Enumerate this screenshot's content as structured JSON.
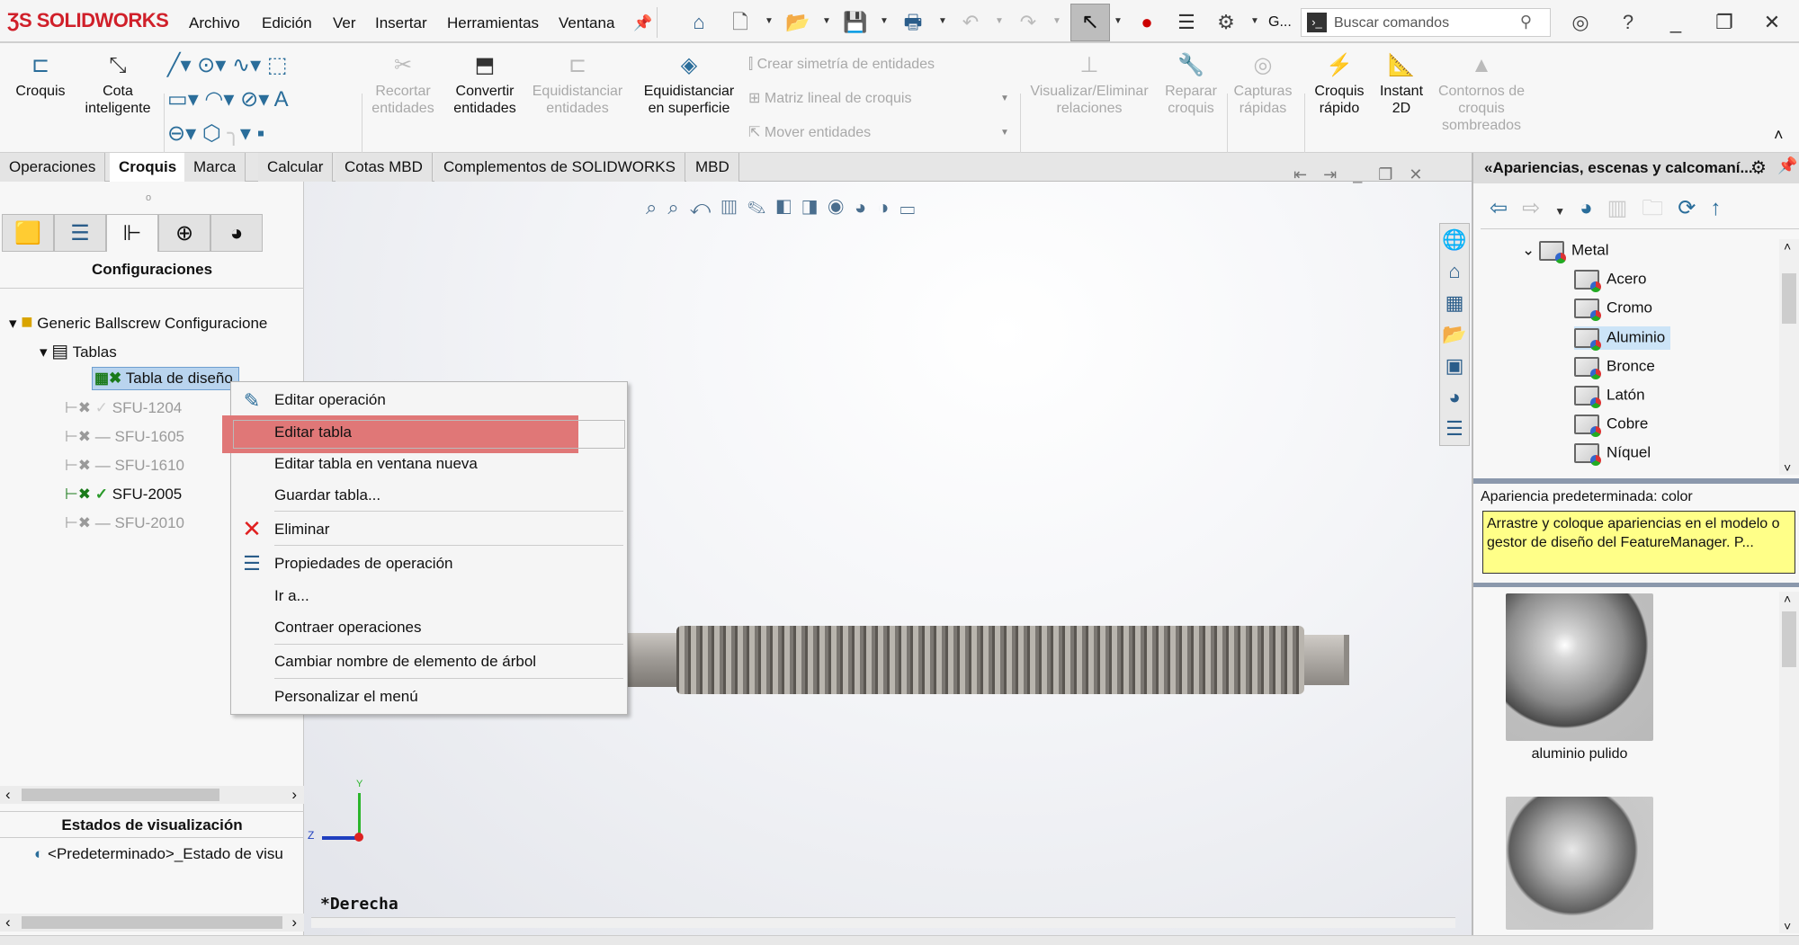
{
  "app": {
    "brand": "SOLIDWORKS"
  },
  "menu": [
    "Archivo",
    "Edición",
    "Ver",
    "Insertar",
    "Herramientas",
    "Ventana"
  ],
  "toolbar": {
    "overflow_label": "G...",
    "search_placeholder": "Buscar comandos"
  },
  "ribbon": {
    "croquis": "Croquis",
    "cota": "Cota inteligente",
    "recortar": "Recortar entidades",
    "convertir": "Convertir entidades",
    "equid": "Equidistanciar entidades",
    "equid_sup": "Equidistanciar en superficie",
    "simetria": "Crear simetría de entidades",
    "matriz": "Matriz lineal de croquis",
    "mover": "Mover entidades",
    "visualizar": "Visualizar/Eliminar relaciones",
    "reparar": "Reparar croquis",
    "capturas": "Capturas rápidas",
    "croquis_rapido": "Croquis rápido",
    "instant2d": "Instant 2D",
    "contornos": "Contornos de croquis sombreados"
  },
  "tabs": [
    {
      "label": "Operaciones"
    },
    {
      "label": "Croquis",
      "active": true
    },
    {
      "label": "Marca"
    },
    {
      "label": "Calcular"
    },
    {
      "label": "Cotas MBD"
    },
    {
      "label": "Complementos de SOLIDWORKS"
    },
    {
      "label": "MBD"
    }
  ],
  "left": {
    "title": "Configuraciones",
    "root": "Generic Ballscrew Configuracione",
    "tables": "Tablas",
    "design_table": "Tabla de diseño",
    "configs": [
      {
        "name": "SFU-1204",
        "active": false
      },
      {
        "name": "SFU-1605",
        "active": false
      },
      {
        "name": "SFU-1610",
        "active": false
      },
      {
        "name": "SFU-2005",
        "active": true
      },
      {
        "name": "SFU-2010",
        "active": false
      }
    ],
    "display_states_title": "Estados de visualización",
    "display_state": "<Predeterminado>_Estado de visu"
  },
  "context_menu": {
    "items": [
      "Editar operación",
      "Editar tabla",
      "Editar tabla en ventana nueva",
      "Guardar tabla...",
      "Eliminar",
      "Propiedades de operación",
      "Ir a...",
      "Contraer operaciones",
      "Cambiar nombre de elemento de árbol",
      "Personalizar el menú"
    ],
    "highlighted": "Editar tabla",
    "highlight_color": "#e07777"
  },
  "viewport": {
    "view_name": "*Derecha",
    "triad": {
      "y": "Y",
      "z": "Z"
    }
  },
  "right": {
    "title": "Apariencias, escenas y calcomaní...",
    "folder": "Metal",
    "items": [
      "Acero",
      "Cromo",
      "Aluminio",
      "Bronce",
      "Latón",
      "Cobre",
      "Níquel"
    ],
    "selected": "Aluminio",
    "default_label": "Apariencia predeterminada: color",
    "hint": "Arrastre y coloque apariencias en el modelo o gestor de diseño del FeatureManager. P...",
    "thumbs": [
      "aluminio pulido"
    ]
  }
}
